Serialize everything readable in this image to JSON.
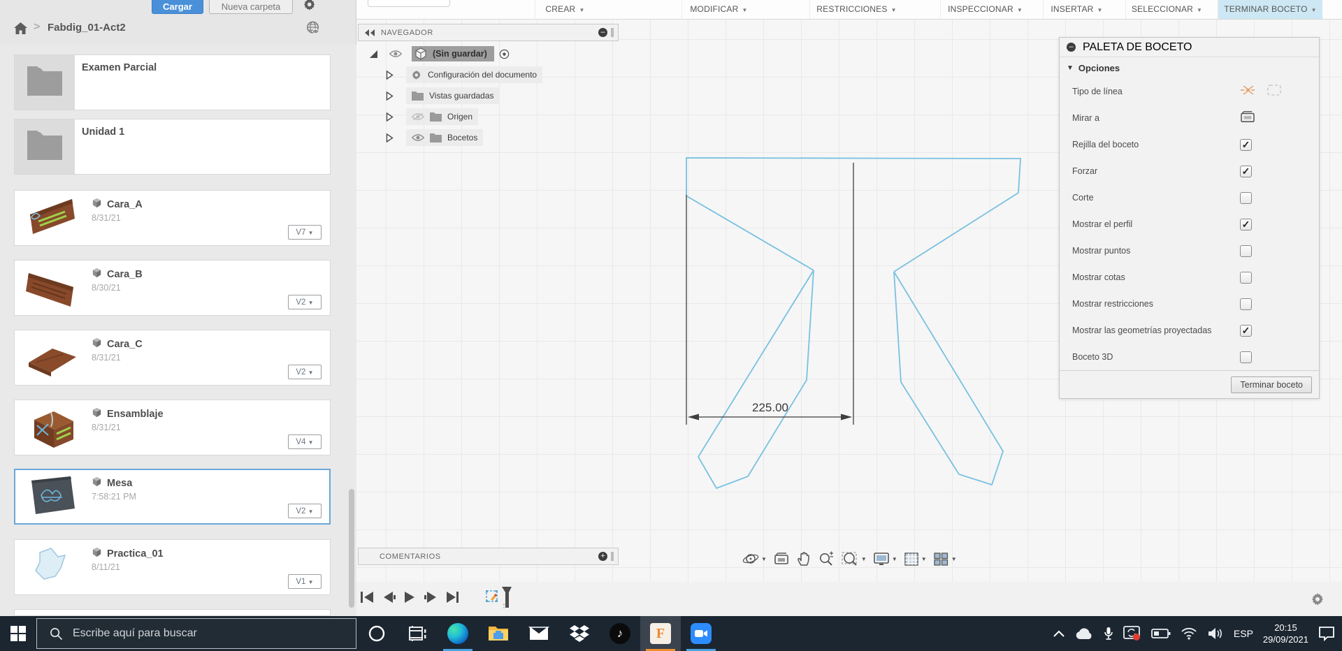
{
  "app": {
    "menus": [
      {
        "label": "CREAR"
      },
      {
        "label": "MODIFICAR"
      },
      {
        "label": "RESTRICCIONES"
      },
      {
        "label": "INSPECCIONAR"
      },
      {
        "label": "INSERTAR"
      },
      {
        "label": "SELECCIONAR"
      },
      {
        "label": "TERMINAR BOCETO",
        "active": true
      }
    ]
  },
  "data_panel": {
    "upload_button": "Cargar",
    "new_folder_button": "Nueva carpeta",
    "breadcrumb": "Fabdig_01-Act2",
    "items": [
      {
        "type": "folder",
        "name": "Examen Parcial"
      },
      {
        "type": "folder",
        "name": "Unidad 1"
      },
      {
        "type": "file",
        "name": "Cara_A",
        "date": "8/31/21",
        "version": "V7",
        "thumb": "plank-a"
      },
      {
        "type": "file",
        "name": "Cara_B",
        "date": "8/30/21",
        "version": "V2",
        "thumb": "plank-b"
      },
      {
        "type": "file",
        "name": "Cara_C",
        "date": "8/31/21",
        "version": "V2",
        "thumb": "sheet"
      },
      {
        "type": "file",
        "name": "Ensamblaje",
        "date": "8/31/21",
        "version": "V4",
        "thumb": "box"
      },
      {
        "type": "file",
        "name": "Mesa",
        "date": "7:58:21 PM",
        "version": "V2",
        "thumb": "mesa",
        "selected": true
      },
      {
        "type": "file",
        "name": "Practica_01",
        "date": "8/11/21",
        "version": "V1",
        "thumb": "blob"
      }
    ]
  },
  "navigator": {
    "title": "NAVEGADOR",
    "root_label": "(Sin guardar)",
    "items": [
      {
        "label": "Configuración del documento",
        "icon": "gear"
      },
      {
        "label": "Vistas guardadas",
        "icon": "folder"
      },
      {
        "label": "Origen",
        "icon": "folder",
        "eye": "off"
      },
      {
        "label": "Bocetos",
        "icon": "folder",
        "eye": "on"
      }
    ]
  },
  "sketch_palette": {
    "title": "PALETA DE BOCETO",
    "section": "Opciones",
    "rows": [
      {
        "label": "Tipo de línea",
        "control": "linetype"
      },
      {
        "label": "Mirar a",
        "control": "lookat"
      },
      {
        "label": "Rejilla del boceto",
        "control": "checkbox",
        "checked": true
      },
      {
        "label": "Forzar",
        "control": "checkbox",
        "checked": true
      },
      {
        "label": "Corte",
        "control": "checkbox",
        "checked": false
      },
      {
        "label": "Mostrar el perfil",
        "control": "checkbox",
        "checked": true
      },
      {
        "label": "Mostrar puntos",
        "control": "checkbox",
        "checked": false
      },
      {
        "label": "Mostrar cotas",
        "control": "checkbox",
        "checked": false
      },
      {
        "label": "Mostrar restricciones",
        "control": "checkbox",
        "checked": false
      },
      {
        "label": "Mostrar las geometrías proyectadas",
        "control": "checkbox",
        "checked": true
      },
      {
        "label": "Boceto 3D",
        "control": "checkbox",
        "checked": false
      }
    ],
    "finish_button": "Terminar boceto"
  },
  "comments": {
    "title": "COMENTARIOS"
  },
  "canvas": {
    "dimension": "225.00"
  },
  "taskbar": {
    "search_placeholder": "Escribe aquí para buscar",
    "language": "ESP",
    "time": "20:15",
    "date": "29/09/2021"
  }
}
